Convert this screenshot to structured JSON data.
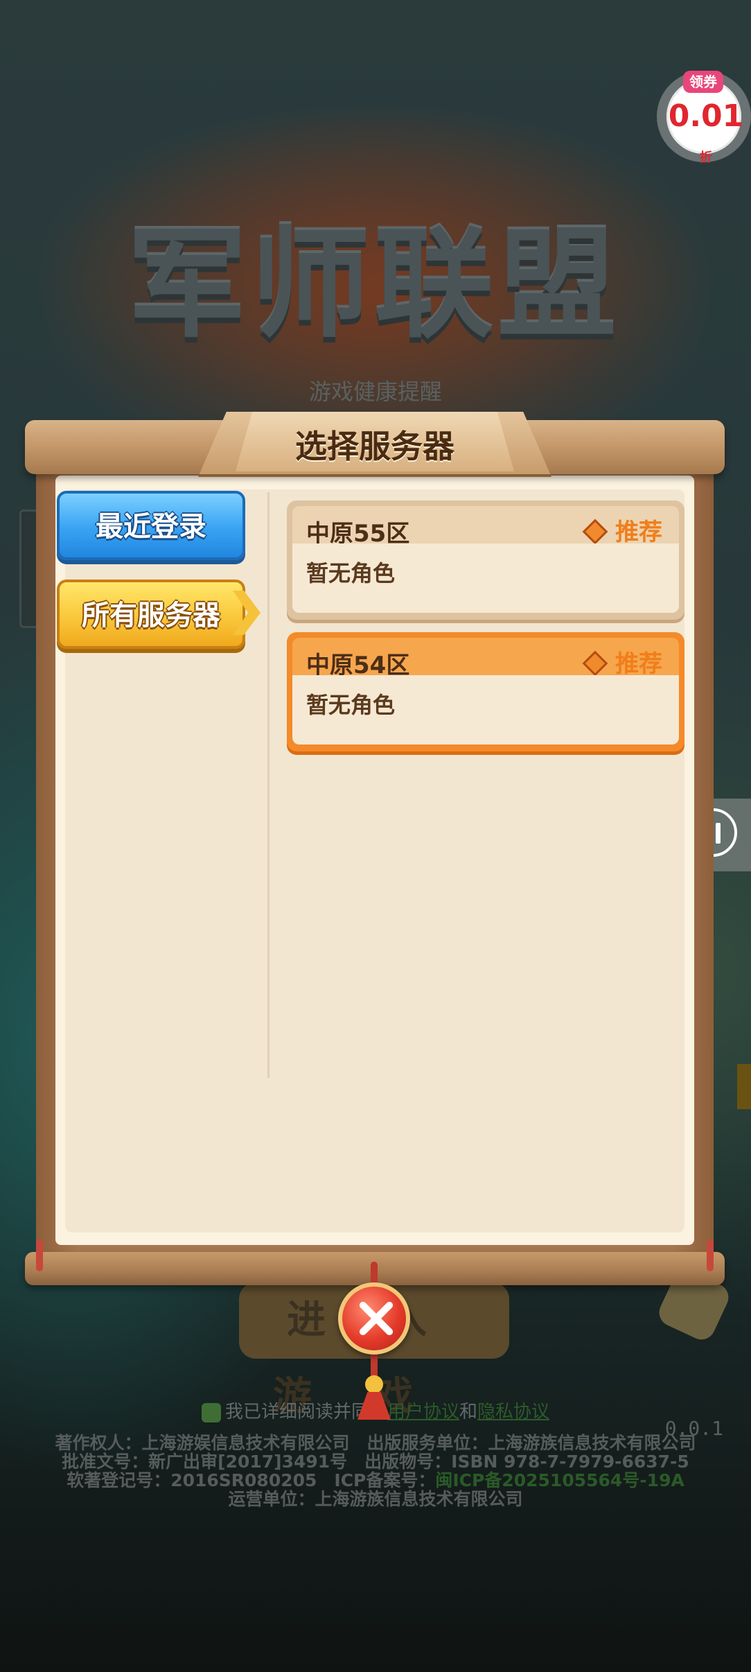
{
  "background": {
    "game_title": "军师联盟",
    "health_notice": "游戏健康提醒",
    "enter_button": "进入游戏",
    "agreement": {
      "prefix": "我已详细阅读并同意",
      "user_agreement": "用户协议",
      "and": "和",
      "privacy": "隐私协议"
    },
    "version": "0.0.1",
    "legal_lines": [
      "著作权人：上海游娱信息技术有限公司　出版服务单位：上海游族信息技术有限公司",
      "批准文号：新广出审[2017]3491号　出版物号：ISBN 978-7-7979-6637-5",
      "软著登记号：2016SR080205　ICP备案号：",
      "运营单位：上海游族信息技术有限公司"
    ],
    "icp_number": "闽ICP备2025105564号-19A"
  },
  "coupon": {
    "tag": "领券",
    "value": "0.01",
    "unit": "折"
  },
  "dialog": {
    "title": "选择服务器",
    "tabs": [
      {
        "label": "最近登录",
        "selected": false
      },
      {
        "label": "所有服务器",
        "selected": true
      }
    ],
    "servers": [
      {
        "name": "中原55区",
        "tag": "推荐",
        "role": "暂无角色",
        "selected": false
      },
      {
        "name": "中原54区",
        "tag": "推荐",
        "role": "暂无角色",
        "selected": true
      }
    ]
  },
  "icons": {
    "close": "close-x-icon",
    "pause": "pause-icon",
    "recommend": "diamond-icon"
  },
  "colors": {
    "recent_tab": "#38a3f3",
    "all_tab": "#fac83b",
    "selected_card": "#f48a2a",
    "recommend_text": "#f07e1a",
    "close_button": "#e43b2a"
  }
}
